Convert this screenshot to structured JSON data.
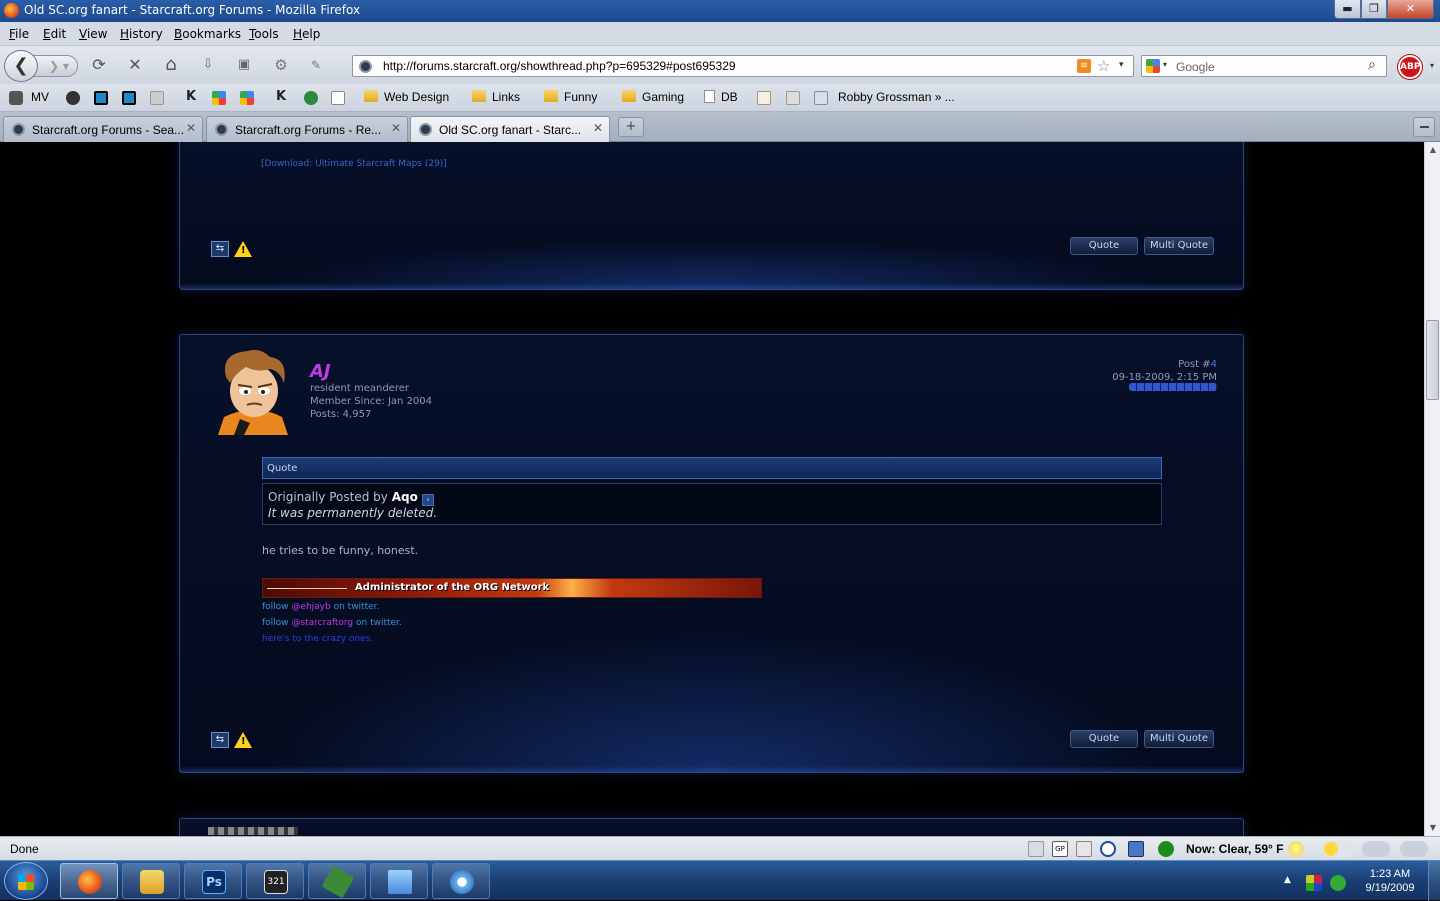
{
  "window": {
    "title": "Old SC.org fanart - Starcraft.org Forums - Mozilla Firefox",
    "minimize_glyph": "▬",
    "maximize_glyph": "❐",
    "close_glyph": "✕"
  },
  "menu": {
    "items": [
      "File",
      "Edit",
      "View",
      "History",
      "Bookmarks",
      "Tools",
      "Help"
    ]
  },
  "nav": {
    "back_glyph": "❮",
    "forward_glyph": "❯ ▾",
    "reload_glyph": "⟳",
    "stop_glyph": "✕",
    "home_glyph": "⌂",
    "url": "http://forums.starcraft.org/showthread.php?p=695329#post695329",
    "rss_glyph": "≋",
    "star_glyph": "☆",
    "url_dropdown_glyph": "▾",
    "search_placeholder": "Google",
    "search_engine_dropdown": "▾",
    "search_glyph": "⌕",
    "adblock_label": "ABP",
    "adblock_dropdown": "▾"
  },
  "bookmarks": {
    "items": [
      "MV",
      "Web Design",
      "Links",
      "Funny",
      "Gaming",
      "DB",
      "Robby Grossman » ..."
    ]
  },
  "tabs": [
    {
      "label": "Starcraft.org Forums - Sea...",
      "close": "✕",
      "active": false
    },
    {
      "label": "Starcraft.org Forums - Re...",
      "close": "✕",
      "active": false
    },
    {
      "label": "Old SC.org fanart - Starc...",
      "close": "✕",
      "active": true
    }
  ],
  "new_tab_glyph": "+",
  "prev_post": {
    "signature_link": "[Download: Ultimate Starcraft Maps (29)]",
    "rep_glyph": "⇆",
    "warn_glyph": "!",
    "quote_label": "Quote",
    "multiquote_label": "Multi Quote"
  },
  "post": {
    "username": "AJ",
    "user_title": "resident meanderer",
    "member_since": "Member Since: Jan 2004",
    "posts": "Posts: 4,957",
    "post_label": "Post #",
    "post_number": "4",
    "date": "09-18-2009, 2:15 PM",
    "quote_header": "Quote",
    "quote_by_prefix": "Originally Posted by",
    "quote_author": "Aqo",
    "quote_arrow": "›",
    "quote_text": "It was permanently deleted.",
    "message": "he tries to be funny, honest.",
    "sig_banner": "Administrator of the ORG Network",
    "sig_line1": {
      "pre": "follow",
      "handle": "@ehjayb",
      "post": "on twitter."
    },
    "sig_line2": {
      "pre": "follow",
      "handle": "@starcraftorg",
      "post": "on twitter."
    },
    "sig_line3": "here's to the crazy ones.",
    "rep_glyph": "⇆",
    "warn_glyph": "!",
    "quote_label": "Quote",
    "multiquote_label": "Multi Quote"
  },
  "scroll": {
    "up_glyph": "▲",
    "down_glyph": "▼"
  },
  "status": {
    "text": "Done",
    "weather": "Now: Clear, 59° F"
  },
  "taskbar": {
    "tray_arrow": "▲",
    "time": "1:23 AM",
    "date": "9/19/2009"
  }
}
